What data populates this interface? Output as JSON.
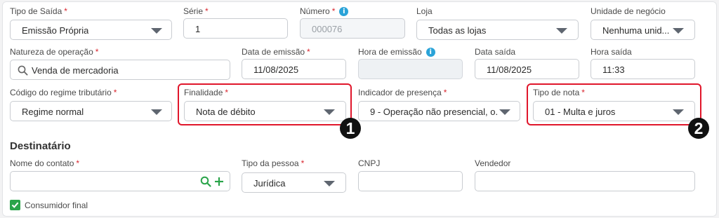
{
  "row1": {
    "tipo_saida": {
      "label": "Tipo de Saída",
      "value": "Emissão Própria"
    },
    "serie": {
      "label": "Série",
      "value": "1"
    },
    "numero": {
      "label": "Número",
      "value": "000076"
    },
    "loja": {
      "label": "Loja",
      "value": "Todas as lojas"
    },
    "unidade": {
      "label": "Unidade de negócio",
      "value": "Nenhuma unid..."
    }
  },
  "row2": {
    "natureza": {
      "label": "Natureza de operação",
      "value": "Venda de mercadoria"
    },
    "data_emissao": {
      "label": "Data de emissão",
      "value": "11/08/2025"
    },
    "hora_emissao": {
      "label": "Hora de emissão",
      "value": ""
    },
    "data_saida": {
      "label": "Data saída",
      "value": "11/08/2025"
    },
    "hora_saida": {
      "label": "Hora saída",
      "value": "11:33"
    }
  },
  "row3": {
    "regime": {
      "label": "Código do regime tributário",
      "value": "Regime normal"
    },
    "finalidade": {
      "label": "Finalidade",
      "value": "Nota de débito"
    },
    "indicador": {
      "label": "Indicador de presença",
      "value": "9 - Operação não presencial, o..."
    },
    "tipo_nota": {
      "label": "Tipo de nota",
      "value": "01 - Multa e juros"
    }
  },
  "annotations": {
    "badge1": "1",
    "badge2": "2",
    "highlight_color": "#e0162b"
  },
  "destinatario": {
    "title": "Destinatário",
    "nome_contato": {
      "label": "Nome do contato",
      "value": ""
    },
    "tipo_pessoa": {
      "label": "Tipo da pessoa",
      "value": "Jurídica"
    },
    "cnpj": {
      "label": "CNPJ",
      "value": ""
    },
    "vendedor": {
      "label": "Vendedor",
      "value": ""
    },
    "consumidor_final": {
      "label": "Consumidor final",
      "checked": true
    }
  },
  "icons": {
    "info": "info-icon",
    "search": "search-icon",
    "add": "plus-icon",
    "dropdown": "chevron-down-icon"
  },
  "colors": {
    "accent_green": "#2aa44a",
    "info_blue": "#2aa3d8",
    "required_red": "#d9262f"
  }
}
